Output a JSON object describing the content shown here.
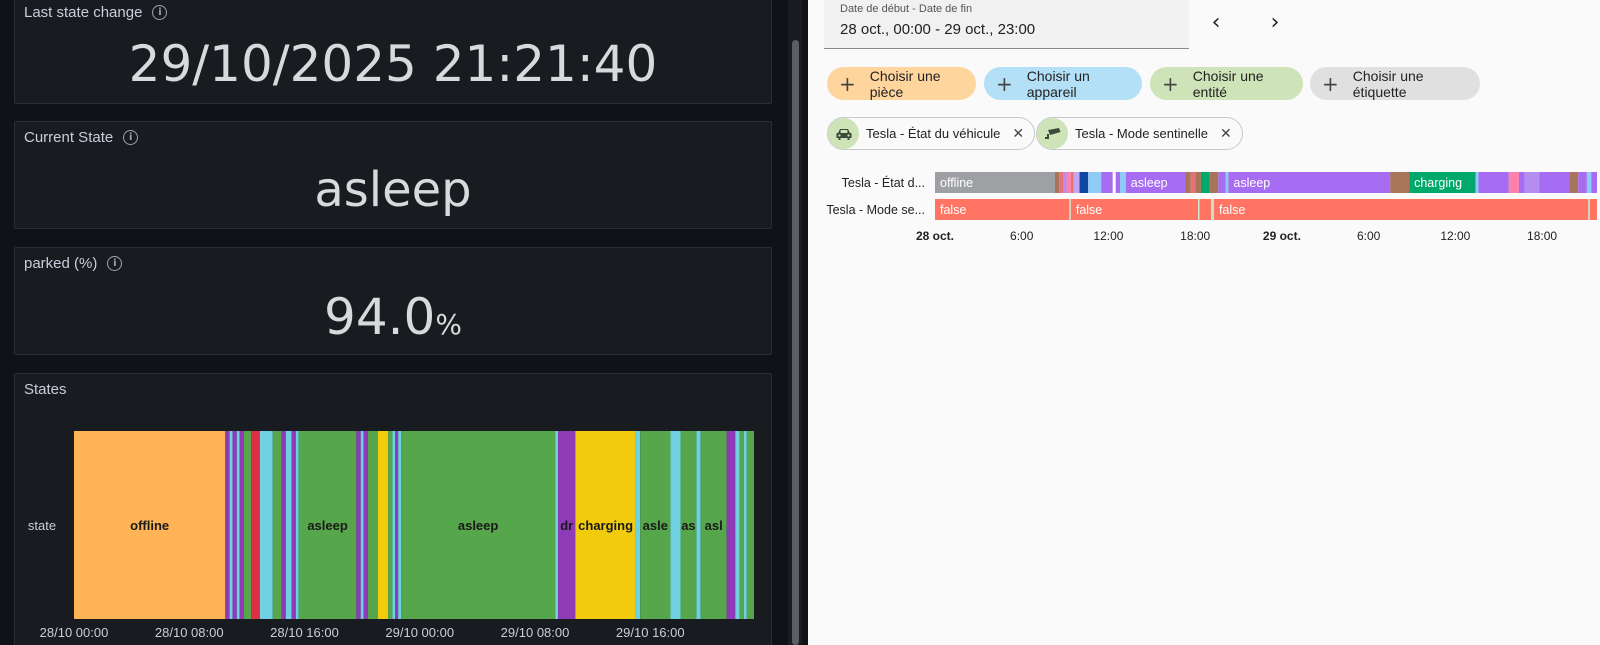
{
  "left": {
    "last_change": {
      "title": "Last state change",
      "value": "29/10/2025 21:21:40"
    },
    "current_state": {
      "title": "Current State",
      "value": "asleep"
    },
    "parked": {
      "title": "parked (%)",
      "value": "94.0",
      "unit": "%"
    },
    "states_panel": {
      "title": "States"
    }
  },
  "right": {
    "date_range": {
      "label": "Date de début - Date de fin",
      "value": "28 oct., 00:00 - 29 oct., 23:00"
    },
    "nav": {
      "prev": "‹",
      "next": "›"
    },
    "filters": [
      {
        "label": "Choisir une pièce",
        "color": "#ffd59e"
      },
      {
        "label": "Choisir un appareil",
        "color": "#b3e0f7"
      },
      {
        "label": "Choisir une entité",
        "color": "#cfe3b8"
      },
      {
        "label": "Choisir une étiquette",
        "color": "#e0e0e0"
      }
    ],
    "entities": [
      {
        "label": "Tesla - État du véhicule",
        "icon": "car-icon"
      },
      {
        "label": "Tesla - Mode sentinelle",
        "icon": "cctv-icon"
      }
    ]
  },
  "chart_data": [
    {
      "type": "state-timeline",
      "title": "States",
      "row_label": "state",
      "x_range": [
        "28/10 00:00",
        "29/10 23:00"
      ],
      "x_ticks": [
        "28/10 00:00",
        "28/10 08:00",
        "28/10 16:00",
        "29/10 00:00",
        "29/10 08:00",
        "29/10 16:00"
      ],
      "legend": {
        "offline": "#ffb357",
        "asleep": "#56a64b",
        "driving": "#8f3bb8",
        "charging": "#f2cc0c",
        "online": "#6ed0e0",
        "error": "#e02f44"
      },
      "segments": [
        {
          "start": 0.0,
          "end": 10.5,
          "state": "offline",
          "label": "offline"
        },
        {
          "start": 10.5,
          "end": 10.8,
          "state": "driving"
        },
        {
          "start": 10.8,
          "end": 11.0,
          "state": "online"
        },
        {
          "start": 11.0,
          "end": 11.3,
          "state": "driving"
        },
        {
          "start": 11.3,
          "end": 11.5,
          "state": "online"
        },
        {
          "start": 11.5,
          "end": 11.8,
          "state": "driving"
        },
        {
          "start": 11.8,
          "end": 12.3,
          "state": "asleep"
        },
        {
          "start": 12.3,
          "end": 12.9,
          "state": "error"
        },
        {
          "start": 12.9,
          "end": 13.8,
          "state": "online"
        },
        {
          "start": 13.8,
          "end": 14.4,
          "state": "asleep"
        },
        {
          "start": 14.4,
          "end": 14.7,
          "state": "driving"
        },
        {
          "start": 14.7,
          "end": 15.1,
          "state": "online"
        },
        {
          "start": 15.1,
          "end": 15.4,
          "state": "driving"
        },
        {
          "start": 15.4,
          "end": 15.6,
          "state": "online"
        },
        {
          "start": 15.6,
          "end": 19.6,
          "state": "asleep",
          "label": "asleep"
        },
        {
          "start": 19.6,
          "end": 19.9,
          "state": "driving"
        },
        {
          "start": 19.9,
          "end": 20.1,
          "state": "online"
        },
        {
          "start": 20.1,
          "end": 20.4,
          "state": "driving"
        },
        {
          "start": 20.4,
          "end": 21.1,
          "state": "asleep"
        },
        {
          "start": 21.1,
          "end": 21.8,
          "state": "charging"
        },
        {
          "start": 21.8,
          "end": 22.1,
          "state": "asleep"
        },
        {
          "start": 22.1,
          "end": 22.3,
          "state": "online"
        },
        {
          "start": 22.3,
          "end": 22.5,
          "state": "driving"
        },
        {
          "start": 22.5,
          "end": 22.7,
          "state": "online"
        },
        {
          "start": 22.7,
          "end": 33.4,
          "state": "asleep",
          "label": "asleep"
        },
        {
          "start": 33.4,
          "end": 33.6,
          "state": "online"
        },
        {
          "start": 33.6,
          "end": 34.8,
          "state": "driving",
          "label": "dr"
        },
        {
          "start": 34.8,
          "end": 39.0,
          "state": "charging",
          "label": "charging"
        },
        {
          "start": 39.0,
          "end": 39.3,
          "state": "online"
        },
        {
          "start": 39.3,
          "end": 41.4,
          "state": "asleep",
          "label": "asle"
        },
        {
          "start": 41.4,
          "end": 42.1,
          "state": "online"
        },
        {
          "start": 42.1,
          "end": 43.2,
          "state": "asleep",
          "label": "as"
        },
        {
          "start": 43.2,
          "end": 43.5,
          "state": "online"
        },
        {
          "start": 43.5,
          "end": 45.3,
          "state": "asleep",
          "label": "asl"
        },
        {
          "start": 45.3,
          "end": 45.9,
          "state": "driving"
        },
        {
          "start": 45.9,
          "end": 46.2,
          "state": "online"
        },
        {
          "start": 46.2,
          "end": 46.5,
          "state": "asleep"
        },
        {
          "start": 46.5,
          "end": 46.7,
          "state": "online"
        },
        {
          "start": 46.7,
          "end": 47.2,
          "state": "asleep"
        }
      ]
    },
    {
      "type": "history-timeline",
      "x_range": [
        "28 oct. 00:00",
        "29 oct. 23:00"
      ],
      "x_ticks": [
        {
          "t": 0,
          "label": "28 oct.",
          "bold": true
        },
        {
          "t": 6,
          "label": "6:00"
        },
        {
          "t": 12,
          "label": "12:00"
        },
        {
          "t": 18,
          "label": "18:00"
        },
        {
          "t": 24,
          "label": "29 oct.",
          "bold": true
        },
        {
          "t": 30,
          "label": "6:00"
        },
        {
          "t": 36,
          "label": "12:00"
        },
        {
          "t": 42,
          "label": "18:00"
        }
      ],
      "rows": [
        {
          "name": "Tesla - État d...",
          "segments": [
            {
              "start": 0.0,
              "end": 8.3,
              "color": "#9ea0a4",
              "label": "offline"
            },
            {
              "start": 8.3,
              "end": 8.6,
              "color": "#a8745a"
            },
            {
              "start": 8.6,
              "end": 8.9,
              "color": "#e57373"
            },
            {
              "start": 8.9,
              "end": 9.1,
              "color": "#b38df0"
            },
            {
              "start": 9.1,
              "end": 9.4,
              "color": "#ff80ab"
            },
            {
              "start": 9.4,
              "end": 9.6,
              "color": "#e57373"
            },
            {
              "start": 9.6,
              "end": 10.0,
              "color": "#c7a3f0"
            },
            {
              "start": 10.0,
              "end": 10.6,
              "color": "#0d47a1"
            },
            {
              "start": 10.6,
              "end": 11.5,
              "color": "#90caf9"
            },
            {
              "start": 11.5,
              "end": 12.3,
              "color": "#a66cf2"
            },
            {
              "start": 12.3,
              "end": 12.5,
              "color": "#ffffff"
            },
            {
              "start": 12.5,
              "end": 12.8,
              "color": "#a66cf2"
            },
            {
              "start": 12.8,
              "end": 13.2,
              "color": "#90caf9"
            },
            {
              "start": 13.2,
              "end": 17.3,
              "color": "#a66cf2",
              "label": "asleep"
            },
            {
              "start": 17.3,
              "end": 17.7,
              "color": "#a8745a"
            },
            {
              "start": 17.7,
              "end": 18.0,
              "color": "#e57373"
            },
            {
              "start": 18.0,
              "end": 18.4,
              "color": "#a8745a"
            },
            {
              "start": 18.4,
              "end": 19.0,
              "color": "#00a86b"
            },
            {
              "start": 19.0,
              "end": 19.6,
              "color": "#a8745a"
            },
            {
              "start": 19.6,
              "end": 20.1,
              "color": "#a66cf2"
            },
            {
              "start": 20.1,
              "end": 20.3,
              "color": "#90caf9"
            },
            {
              "start": 20.3,
              "end": 31.5,
              "color": "#a66cf2",
              "label": "asleep"
            },
            {
              "start": 31.5,
              "end": 32.8,
              "color": "#a8745a"
            },
            {
              "start": 32.8,
              "end": 37.4,
              "color": "#00a86b",
              "label": "charging"
            },
            {
              "start": 37.4,
              "end": 37.6,
              "color": "#90caf9"
            },
            {
              "start": 37.6,
              "end": 39.7,
              "color": "#a66cf2"
            },
            {
              "start": 39.7,
              "end": 40.4,
              "color": "#ff80ab"
            },
            {
              "start": 40.4,
              "end": 40.8,
              "color": "#a66cf2"
            },
            {
              "start": 40.8,
              "end": 41.8,
              "color": "#b38df0"
            },
            {
              "start": 41.8,
              "end": 43.9,
              "color": "#a66cf2"
            },
            {
              "start": 43.9,
              "end": 44.5,
              "color": "#a8745a"
            },
            {
              "start": 44.5,
              "end": 45.1,
              "color": "#a66cf2"
            },
            {
              "start": 45.1,
              "end": 45.4,
              "color": "#90caf9"
            },
            {
              "start": 45.4,
              "end": 45.8,
              "color": "#a66cf2"
            }
          ]
        },
        {
          "name": "Tesla - Mode se...",
          "segments": [
            {
              "start": 0.0,
              "end": 9.3,
              "color": "#ff7463",
              "label": "false"
            },
            {
              "start": 9.3,
              "end": 9.4,
              "color": "#c8e6c9"
            },
            {
              "start": 9.4,
              "end": 18.2,
              "color": "#ff7463",
              "label": "false"
            },
            {
              "start": 18.2,
              "end": 18.3,
              "color": "#c8e6c9"
            },
            {
              "start": 18.3,
              "end": 19.1,
              "color": "#ff7463"
            },
            {
              "start": 19.1,
              "end": 19.3,
              "color": "#c8e6c9"
            },
            {
              "start": 19.3,
              "end": 45.2,
              "color": "#ff7463",
              "label": "false"
            },
            {
              "start": 45.2,
              "end": 45.3,
              "color": "#c8e6c9"
            },
            {
              "start": 45.3,
              "end": 45.8,
              "color": "#ff7463"
            }
          ]
        }
      ]
    }
  ]
}
